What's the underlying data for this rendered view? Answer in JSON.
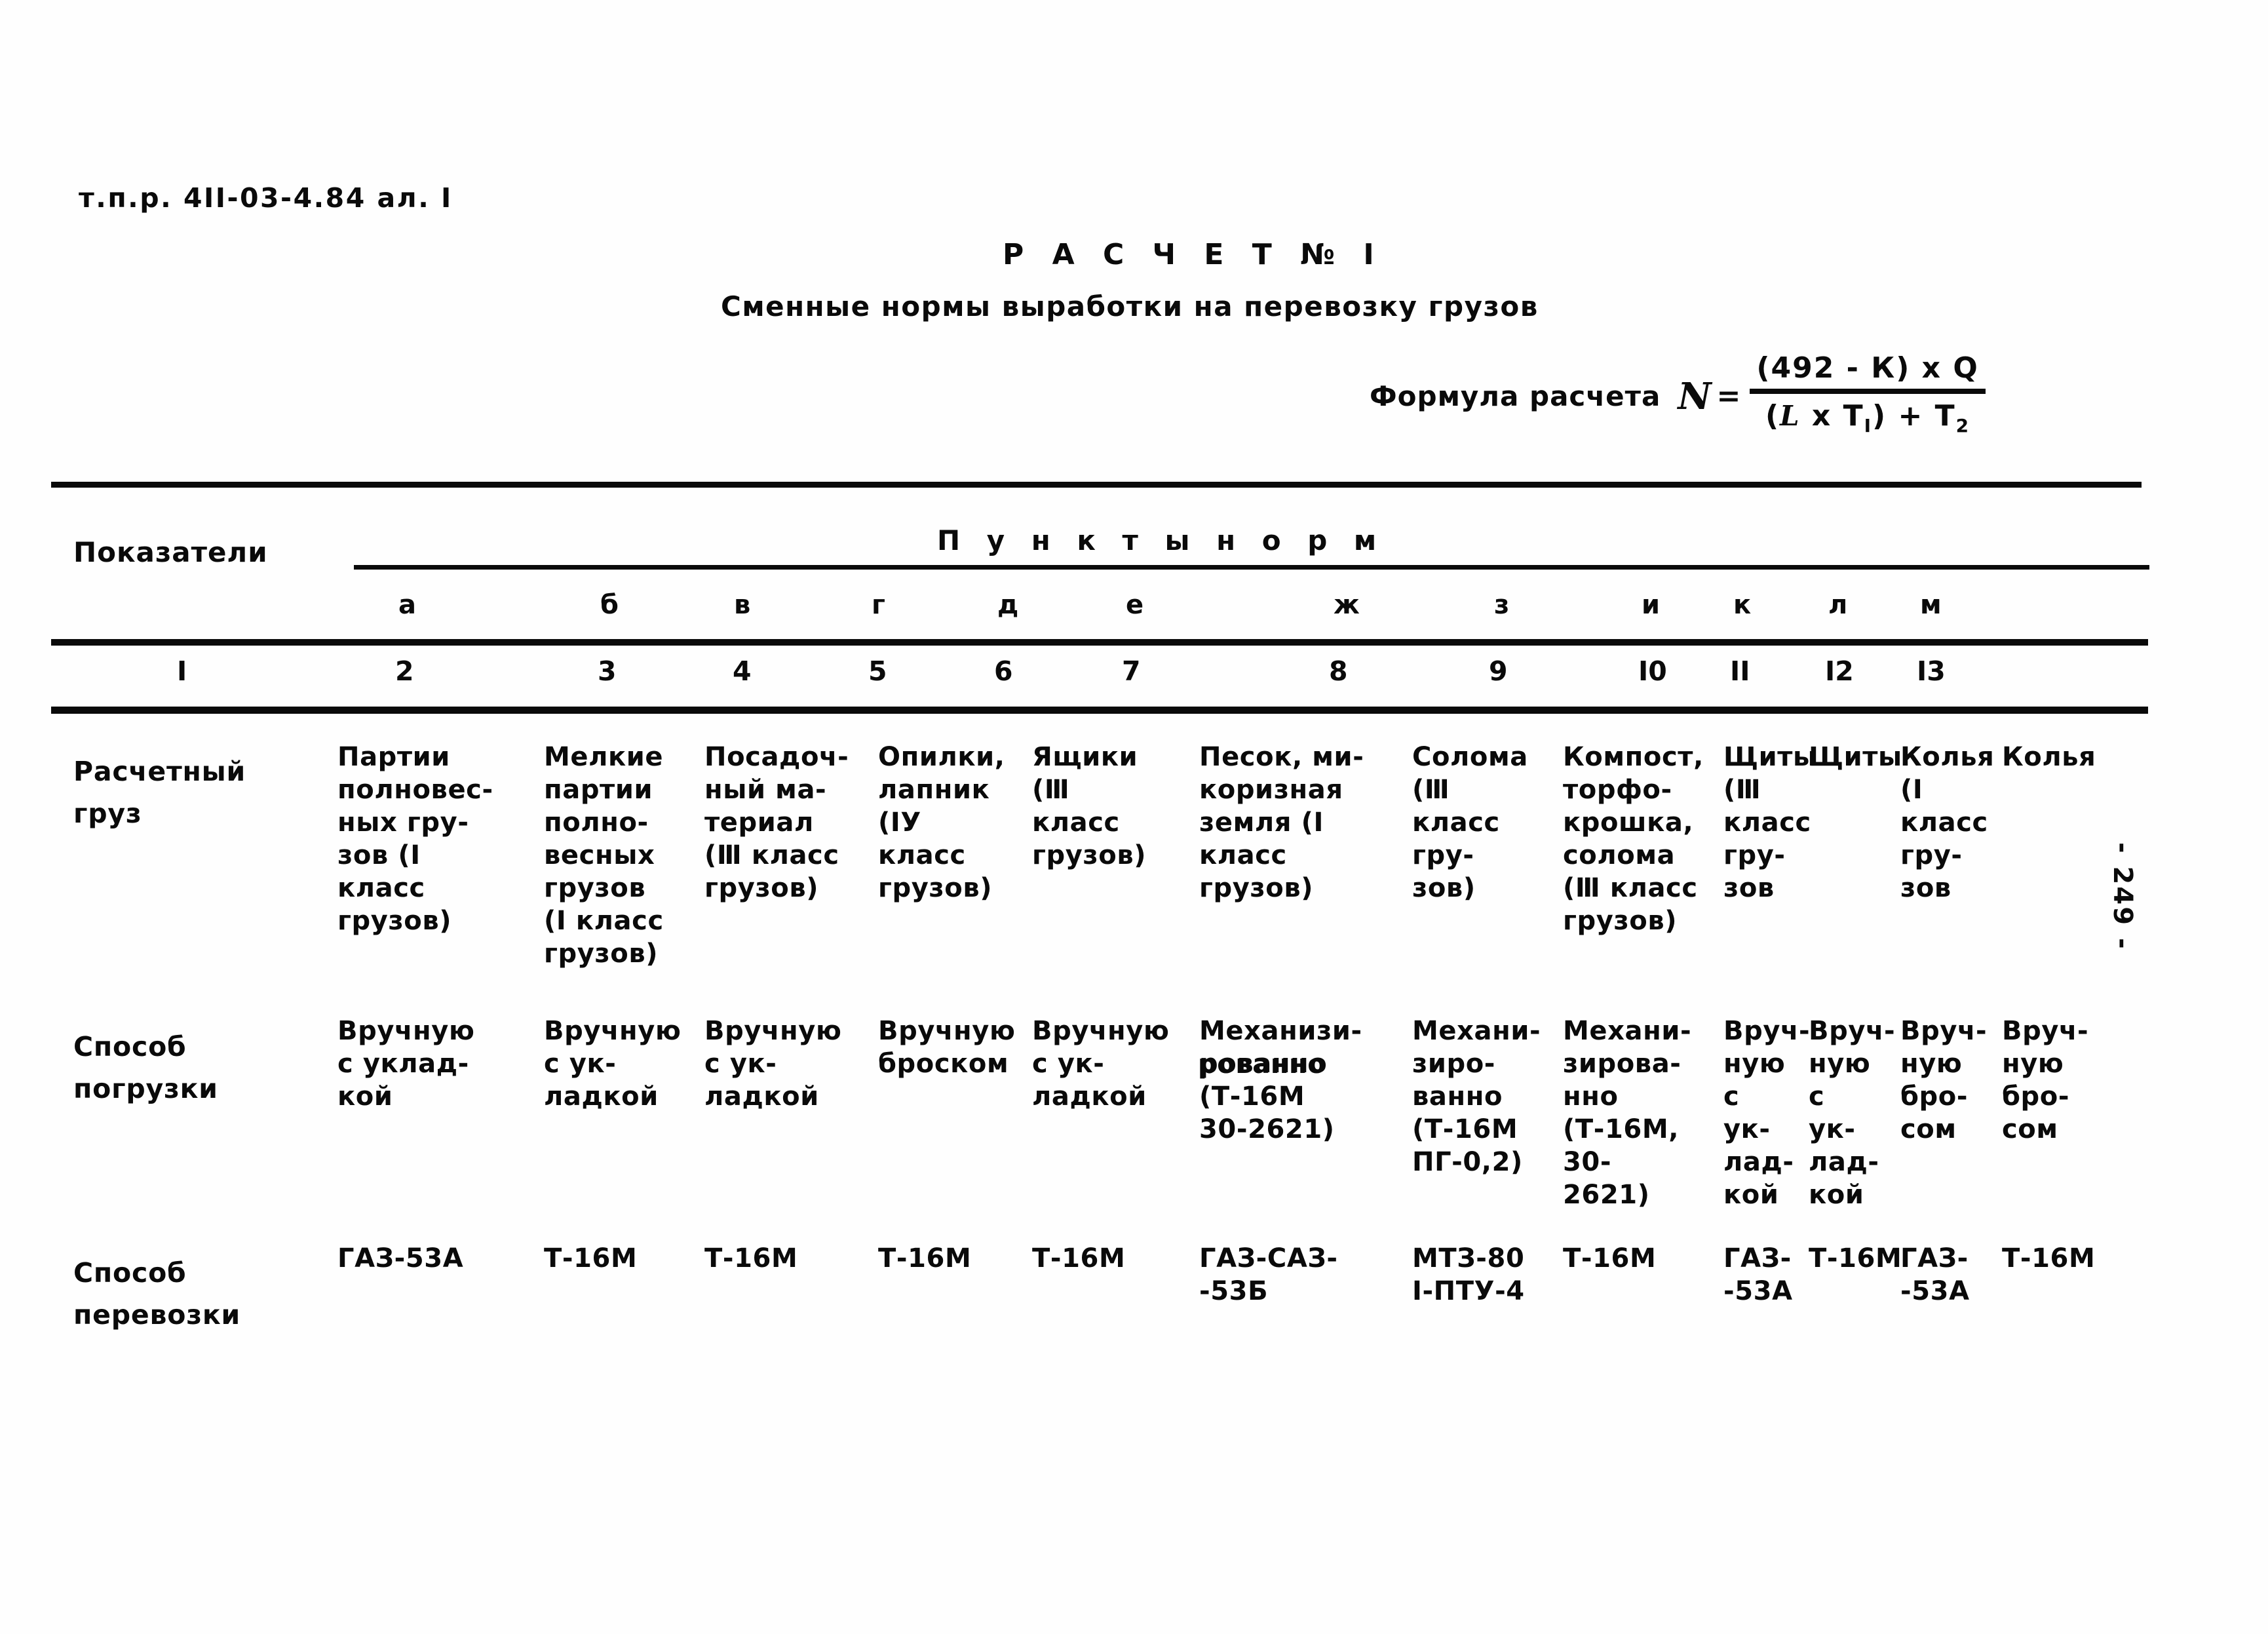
{
  "document": {
    "code": "т.п.р. 4II-03-4.84 ал. I",
    "page_number": "- 249 -"
  },
  "title": {
    "main": "Р А С Ч Е Т   №   I",
    "subtitle": "Сменные нормы выработки на перевозку грузов"
  },
  "formula": {
    "label": "Формула расчета",
    "symbol": "N",
    "equals": "=",
    "numerator": "(492 - К)  х  Q",
    "denominator_pre": "(",
    "denominator_l": "L",
    "denominator_mid": " х T",
    "denominator_sub1": "I",
    "denominator_post": ") + T",
    "denominator_sub2": "2"
  },
  "table": {
    "indicator_header": "Показатели",
    "group_header": "П у н к т ы   н о р м",
    "letters": [
      "а",
      "б",
      "в",
      "г",
      "д",
      "е",
      "ж",
      "з",
      "и",
      "к",
      "л",
      "м"
    ],
    "numbers": [
      "I",
      "2",
      "3",
      "4",
      "5",
      "6",
      "7",
      "8",
      "9",
      "I0",
      "II",
      "I2",
      "I3"
    ],
    "rows": [
      {
        "label": "Расчетный\nгруз",
        "cells": [
          "Партии\nполновес-\nных гру-\nзов (I\nкласс\nгрузов)",
          "Мелкие\nпартии\nполно-\nвесных\nгрузов\n(I класс\nгрузов)",
          "Посадоч-\nный ма-\nтериал\n(Ⅲ класс\n  грузов)",
          "Опилки,\nлапник\n(IУ\nкласс\nгрузов)",
          "Ящики\n(Ⅲ\nкласс\nгрузов)",
          "Песок, ми-\nкоризная\nземля (I\nкласс\nгрузов)",
          "Солома\n(Ⅲ\nкласс\nгру-\nзов)",
          "Компост,\nторфо-\nкрошка,\nсолома\n(Ⅲ класс\nгрузов)",
          "Щиты\n(Ⅲ\nкласс\nгру-\nзов",
          "Щиты",
          "Колья\n(I\nкласс\nгру-\nзов",
          "Колья"
        ]
      },
      {
        "label": "Способ\nпогрузки",
        "cells": [
          "Вручную\nс уклад-\nкой",
          "Вручную\nс ук-\nладкой",
          "Вручную\nс ук-\nладкой",
          "Вручную\nброском",
          "Вручную\nс ук-\nладкой",
          "Механизи-\nрованно\n(Т-16М\n30-2621)",
          "Механи-\nзиро-\nванно\n(Т-16М\nПГ-0,2)",
          "Механи-\nзирова-\nнно\n(Т-16М,\n30-\n2621)",
          "Вруч-\nную\nс\nук-\nлад-\nкой",
          "Вруч-\nную\nс\nук-\nлад-\nкой",
          "Вруч-\nную\nбро-\nсом",
          "Вруч-\nную\nбро-\nсом"
        ],
        "overstrike_cell_index": 5,
        "overstrike_text": "рованно"
      },
      {
        "label": "Способ\nперевозки",
        "cells": [
          "ГАЗ-53А",
          "Т-16М",
          "Т-16М",
          "Т-16М",
          "Т-16М",
          "ГАЗ-САЗ-\n-53Б",
          "МТЗ-80\nI-ПТУ-4",
          "Т-16М",
          "ГАЗ-\n-53А",
          "Т-16М",
          "ГАЗ-\n-53А",
          "Т-16М"
        ]
      }
    ]
  }
}
